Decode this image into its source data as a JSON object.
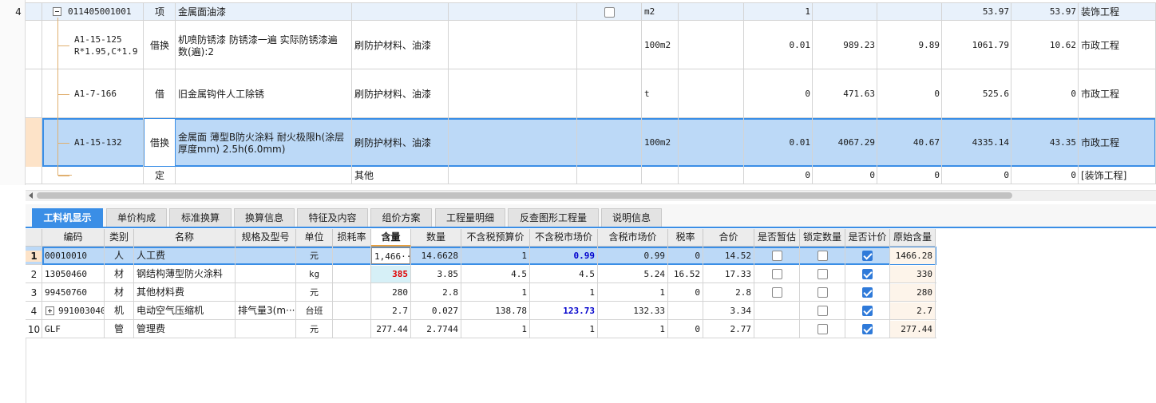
{
  "upper": {
    "rows": [
      {
        "idx": "4",
        "code": "011405001001",
        "type": "项",
        "name": "金属面油漆",
        "feature": "",
        "unit": "m2",
        "qty": "1",
        "p1": "",
        "p2": "",
        "p3": "53.97",
        "p4": "53.97",
        "prof": "装饰工程"
      },
      {
        "idx": "",
        "code": "A1-15-125",
        "code2": "R*1.95,C*1.9",
        "type": "借换",
        "name": "机喷防锈漆 防锈漆一遍  实际防锈漆遍",
        "name2": "数(遍):2",
        "feature": "刷防护材料、油漆",
        "unit": "100m2",
        "qty": "0.01",
        "p1": "989.23",
        "p2": "9.89",
        "p3": "1061.79",
        "p4": "10.62",
        "prof": "市政工程"
      },
      {
        "idx": "",
        "code": "A1-7-166",
        "type": "借",
        "name": "旧金属钩件人工除锈",
        "feature": "刷防护材料、油漆",
        "unit": "t",
        "qty": "0",
        "p1": "471.63",
        "p2": "0",
        "p3": "525.6",
        "p4": "0",
        "prof": "市政工程"
      },
      {
        "idx": "",
        "code": "A1-15-132",
        "type": "借换",
        "name": "金属面 薄型B防火涂料 耐火极限h(涂层",
        "name2": "厚度mm) 2.5h(6.0mm)",
        "feature": "刷防护材料、油漆",
        "unit": "100m2",
        "qty": "0.01",
        "p1": "4067.29",
        "p2": "40.67",
        "p3": "4335.14",
        "p4": "43.35",
        "prof": "市政工程"
      },
      {
        "idx": "",
        "code": "",
        "type": "定",
        "name": "",
        "feature": "其他",
        "unit": "",
        "qty": "0",
        "p1": "0",
        "p2": "0",
        "p3": "0",
        "p4": "0",
        "prof": "[装饰工程]"
      }
    ]
  },
  "tabs": [
    "工料机显示",
    "单价构成",
    "标准换算",
    "换算信息",
    "特征及内容",
    "组价方案",
    "工程量明细",
    "反查图形工程量",
    "说明信息"
  ],
  "lower": {
    "headers": [
      "编码",
      "类别",
      "名称",
      "规格及型号",
      "单位",
      "损耗率",
      "含量",
      "数量",
      "不含税预算价",
      "不含税市场价",
      "含税市场价",
      "税率",
      "合价",
      "是否暂估",
      "锁定数量",
      "是否计价",
      "原始含量"
    ],
    "rows": [
      {
        "idx": "1",
        "code": "00010010",
        "cat": "人",
        "name": "人工费",
        "spec": "",
        "unit": "元",
        "loss": "",
        "content": "1,466···",
        "qty": "14.6628",
        "p1": "1",
        "p2": "0.99",
        "p3": "0.99",
        "tax": "0",
        "total": "14.52",
        "est": false,
        "lock": false,
        "priced": true,
        "orig": "1466.28"
      },
      {
        "idx": "2",
        "code": "13050460",
        "cat": "材",
        "name": "钢结构薄型防火涂料",
        "spec": "",
        "unit": "kg",
        "loss": "",
        "content": "385",
        "qty": "3.85",
        "p1": "4.5",
        "p2": "4.5",
        "p3": "5.24",
        "tax": "16.52",
        "total": "17.33",
        "est": false,
        "lock": false,
        "priced": true,
        "orig": "330"
      },
      {
        "idx": "3",
        "code": "99450760",
        "cat": "材",
        "name": "其他材料费",
        "spec": "",
        "unit": "元",
        "loss": "",
        "content": "280",
        "qty": "2.8",
        "p1": "1",
        "p2": "1",
        "p3": "1",
        "tax": "0",
        "total": "2.8",
        "est": false,
        "lock": false,
        "priced": true,
        "orig": "280"
      },
      {
        "idx": "4",
        "code": "991003040",
        "cat": "机",
        "name": "电动空气压缩机",
        "spec": "排气量3(m···",
        "unit": "台班",
        "loss": "",
        "content": "2.7",
        "qty": "0.027",
        "p1": "138.78",
        "p2": "123.73",
        "p3": "132.33",
        "tax": "",
        "total": "3.34",
        "est": null,
        "lock": false,
        "priced": true,
        "orig": "2.7"
      },
      {
        "idx": "10",
        "code": "GLF",
        "cat": "管",
        "name": "管理费",
        "spec": "",
        "unit": "元",
        "loss": "",
        "content": "277.44",
        "qty": "2.7744",
        "p1": "1",
        "p2": "1",
        "p3": "1",
        "tax": "0",
        "total": "2.77",
        "est": null,
        "lock": false,
        "priced": true,
        "orig": "277.44"
      }
    ]
  },
  "colors": {
    "selection": "#bcd9f7",
    "accent": "#3a8ee6",
    "red": "#e00000",
    "blue": "#0000cc",
    "gridline": "#d4d4d4"
  }
}
